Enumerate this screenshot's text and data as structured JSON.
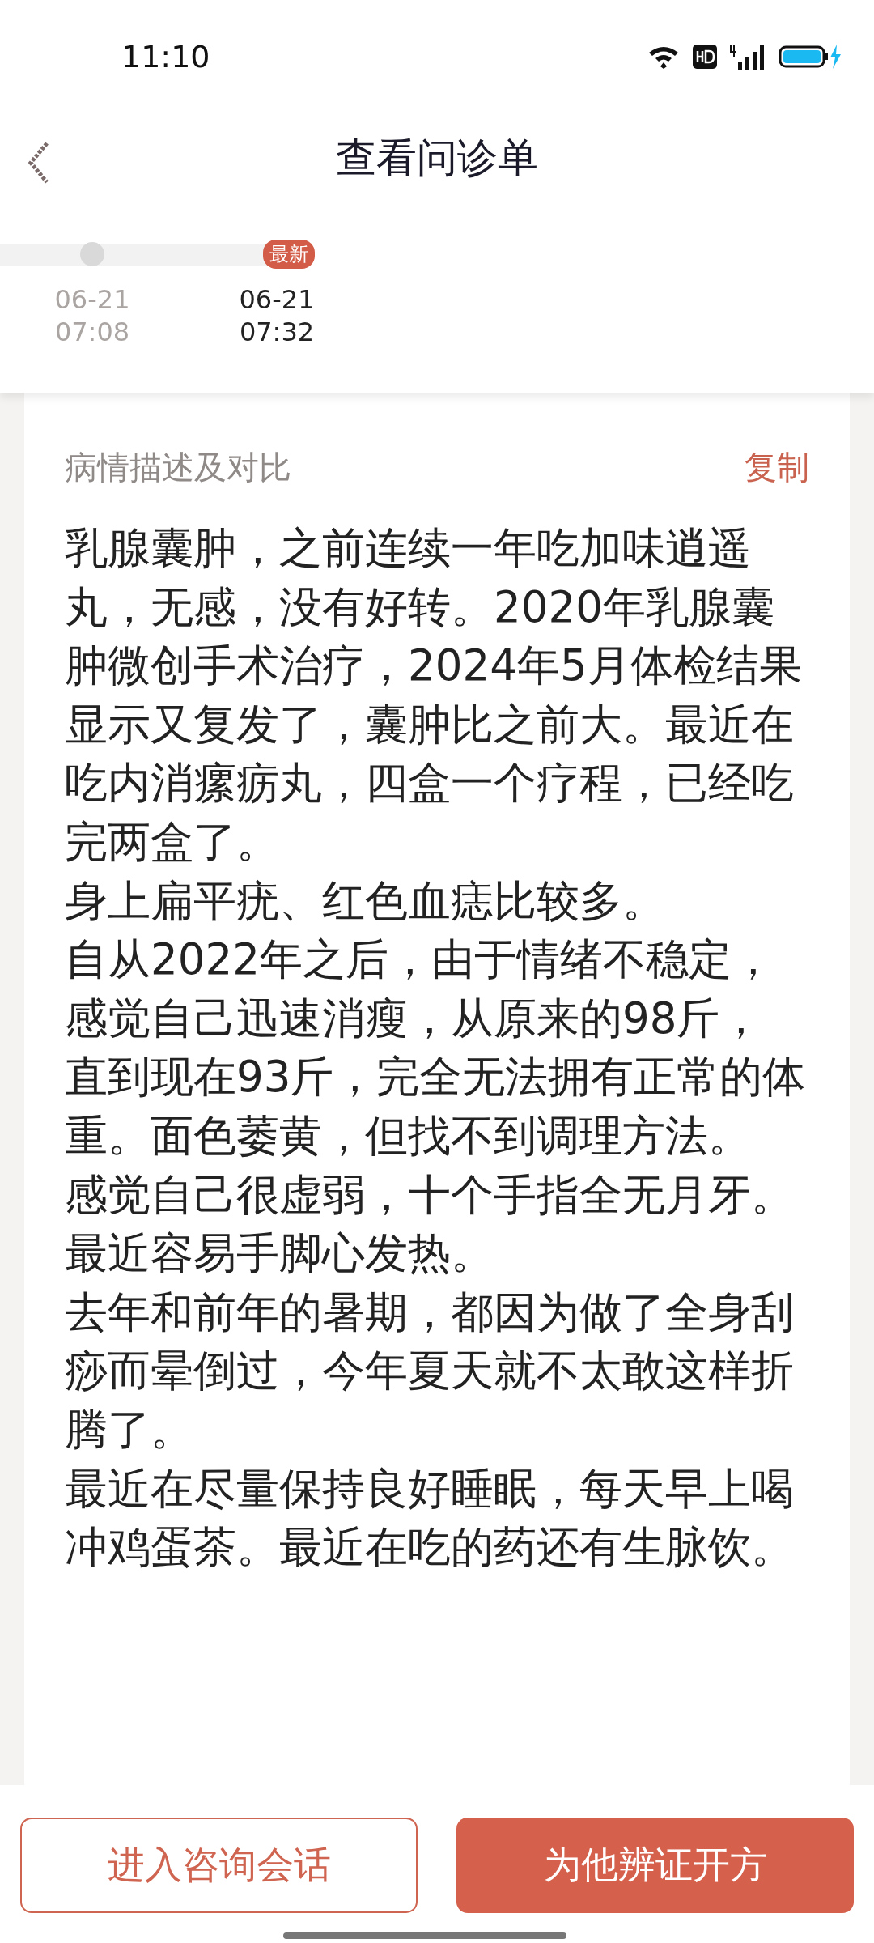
{
  "status_bar": {
    "time": "11:10"
  },
  "header": {
    "title": "查看问诊单"
  },
  "timeline": [
    {
      "date": "06-21",
      "time": "07:08",
      "selected": false
    },
    {
      "date": "06-21",
      "time": "07:32",
      "selected": true,
      "badge": "最新"
    }
  ],
  "section": {
    "title": "病情描述及对比",
    "action": "复制",
    "paragraphs": [
      "乳腺囊肿，之前连续一年吃加味逍遥丸，无感，没有好转。2020年乳腺囊肿微创手术治疗，2024年5月体检结果显示又复发了，囊肿比之前大。最近在吃内消瘰疬丸，四盒一个疗程，已经吃完两盒了。",
      "身上扁平疣、红色血痣比较多。",
      "自从2022年之后，由于情绪不稳定，",
      "感觉自己迅速消瘦，从原来的98斤，",
      "直到现在93斤，完全无法拥有正常的体重。面色萎黄，但找不到调理方法。",
      "感觉自己很虚弱，十个手指全无月牙。",
      "最近容易手脚心发热。",
      "去年和前年的暑期，都因为做了全身刮痧而晕倒过，今年夏天就不太敢这样折腾了。",
      "最近在尽量保持良好睡眠，每天早上喝冲鸡蛋茶。最近在吃的药还有生脉饮。"
    ]
  },
  "buttons": [
    {
      "label": "进入咨询会话",
      "kind": "outline"
    },
    {
      "label": "为他辨证开方",
      "kind": "primary"
    }
  ]
}
